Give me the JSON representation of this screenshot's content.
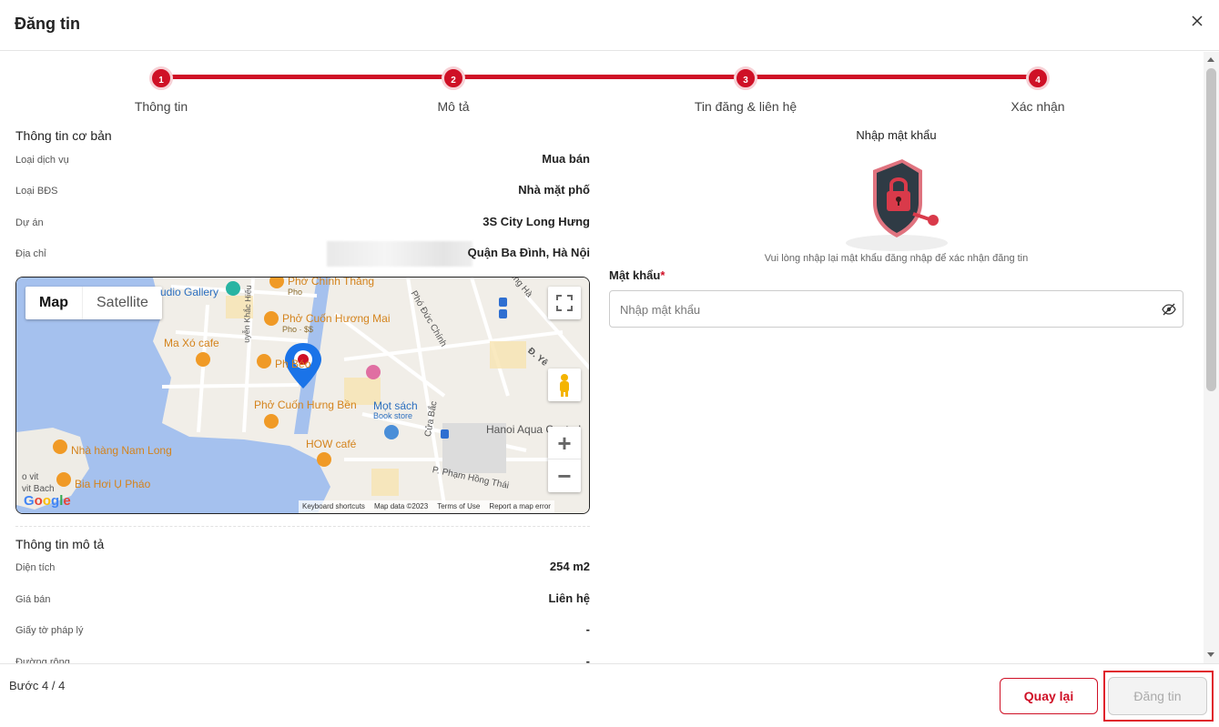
{
  "modal": {
    "title": "Đăng tin"
  },
  "stepper": {
    "steps": [
      {
        "number": "1",
        "label": "Thông tin"
      },
      {
        "number": "2",
        "label": "Mô tả"
      },
      {
        "number": "3",
        "label": "Tin đăng & liên hệ"
      },
      {
        "number": "4",
        "label": "Xác nhận"
      }
    ],
    "accent": "#cf1026"
  },
  "basic_info": {
    "title": "Thông tin cơ bản",
    "rows": [
      {
        "key": "Loại dịch vụ",
        "value": "Mua bán"
      },
      {
        "key": "Loại BĐS",
        "value": "Nhà mặt phố"
      },
      {
        "key": "Dự án",
        "value": "3S City Long Hưng"
      },
      {
        "key": "Địa chỉ",
        "value": "Quận Ba Đình, Hà Nội"
      }
    ]
  },
  "map": {
    "type_map": "Map",
    "type_satellite": "Satellite",
    "labels": {
      "studio_gallery": "udio Gallery",
      "pho_chinh_thang": "Phở Chính Thắng",
      "pho_small": "Pho",
      "pho_cuon_huong_mai": "Phở Cuốn Hương Mai",
      "pho_price": "Pho · $$",
      "ma_xo_cafe": "Ma Xó cafe",
      "pho_beo": "Ph     Béo",
      "pho_cuon_hung_ben": "Phở Cuốn Hưng Bền",
      "mot_sach": "Mọt sách",
      "book_store": "Book store",
      "how_cafe": "HOW café",
      "nha_hang_nam_long": "Nhà hàng Nam Long",
      "bia_hoi": "Bia Hơi Ụ Pháo",
      "hanoi_aqua": "Hanoi Aqua Central",
      "pho_duc_chinh": "Phó Đức Chính",
      "cua_bac": "Cửa Bắc",
      "pham_hong_thai": "P. Phạm Hồng Thái",
      "hong_ha": "Hồng Hà",
      "yen": "Đ. Yê",
      "khac_hieu": "uyễn Khắc Hiếu",
      "vit_bach": "vit Bach",
      "o_vit": "o vit"
    },
    "footer": {
      "shortcuts": "Keyboard shortcuts",
      "data": "Map data ©2023",
      "terms": "Terms of Use",
      "report": "Report a map error"
    },
    "logo": "Google"
  },
  "description_info": {
    "title": "Thông tin mô tả",
    "rows": [
      {
        "key": "Diện tích",
        "value": "254 m2"
      },
      {
        "key": "Giá bán",
        "value": "Liên hệ"
      },
      {
        "key": "Giấy tờ pháp lý",
        "value": "-"
      },
      {
        "key": "Đường rộng",
        "value": "-"
      }
    ]
  },
  "password": {
    "heading": "Nhập mật khẩu",
    "hint": "Vui lòng nhập lại mật khẩu đăng nhập để xác nhận đăng tin",
    "label": "Mật khẩu",
    "required_mark": "*",
    "placeholder": "Nhập mật khẩu",
    "value": ""
  },
  "footer": {
    "step_count": "Bước 4 / 4",
    "back_label": "Quay lại",
    "post_label": "Đăng tin"
  }
}
